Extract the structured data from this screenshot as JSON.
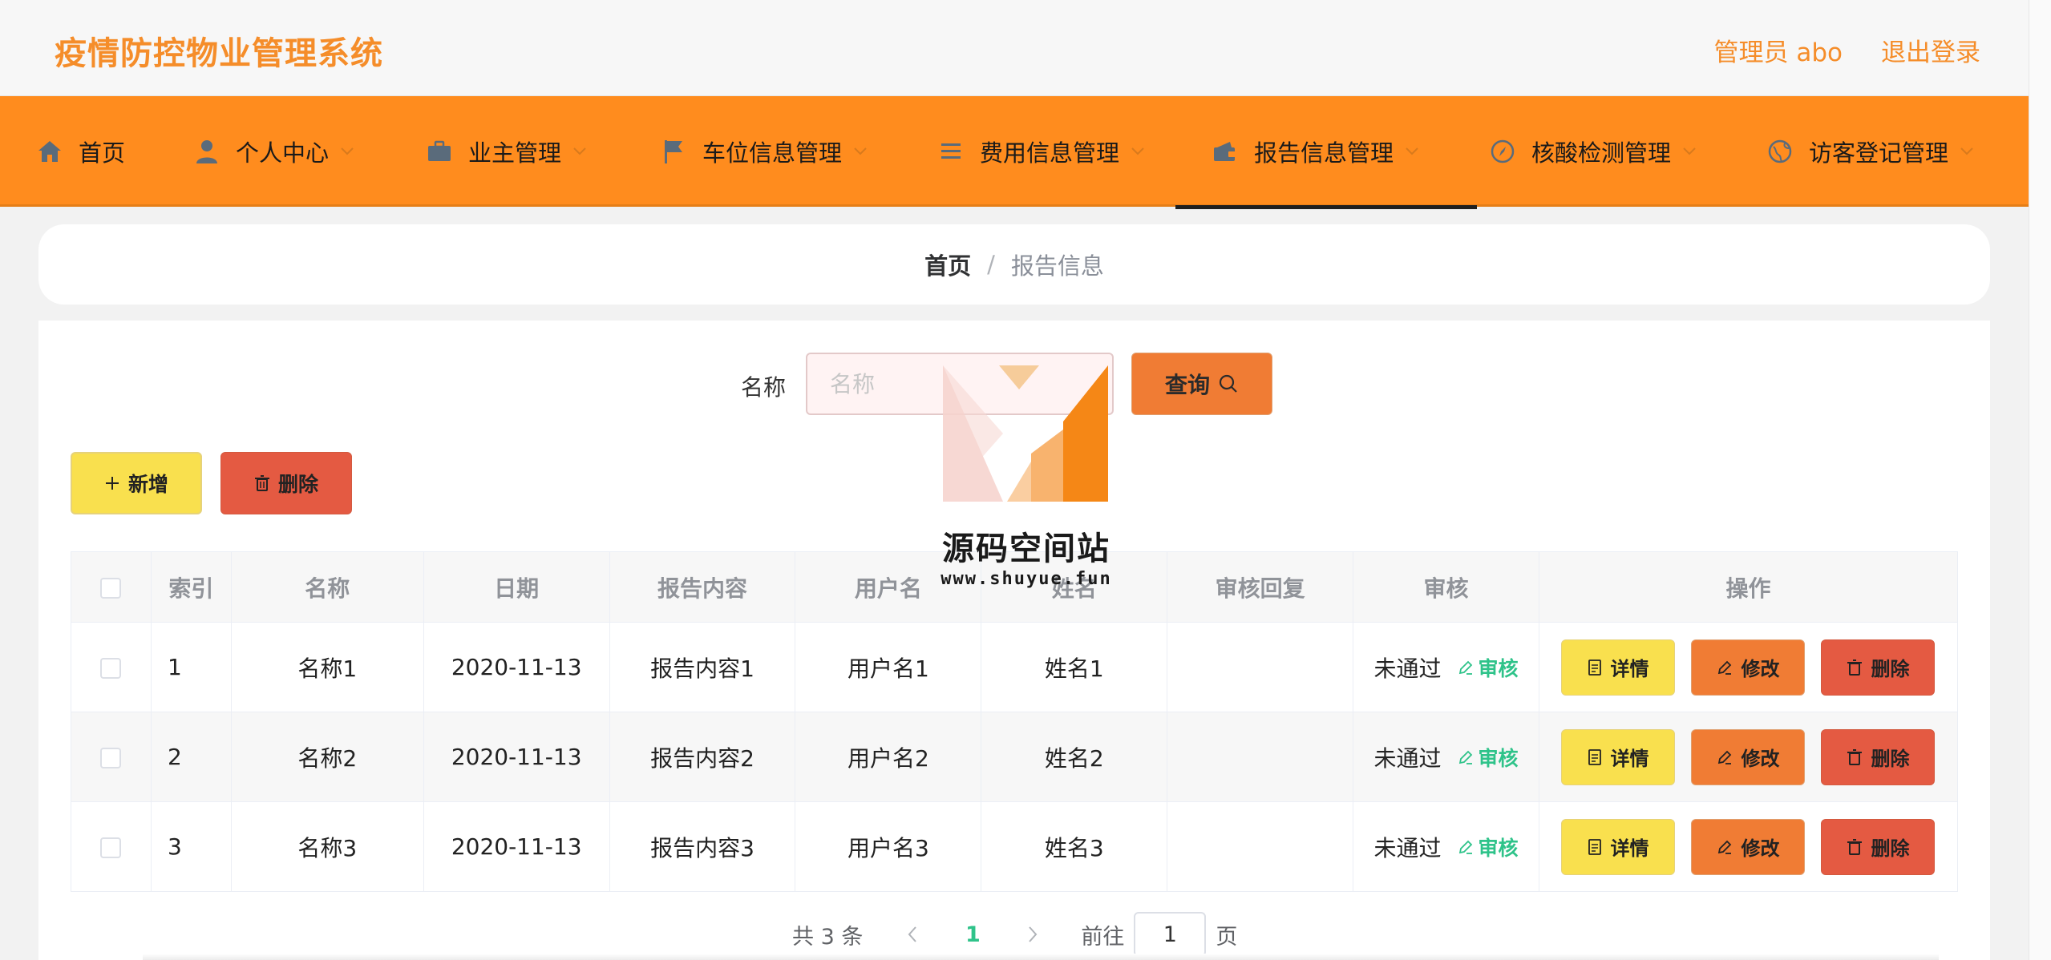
{
  "header": {
    "title": "疫情防控物业管理系统",
    "user_label": "管理员 abo",
    "logout_label": "退出登录"
  },
  "nav": {
    "items": [
      {
        "label": "首页",
        "icon": "home-icon"
      },
      {
        "label": "个人中心",
        "icon": "user-icon"
      },
      {
        "label": "业主管理",
        "icon": "briefcase-icon"
      },
      {
        "label": "车位信息管理",
        "icon": "flag-icon"
      },
      {
        "label": "费用信息管理",
        "icon": "list-icon"
      },
      {
        "label": "报告信息管理",
        "icon": "wallet-icon"
      },
      {
        "label": "核酸检测管理",
        "icon": "compass-icon"
      },
      {
        "label": "访客登记管理",
        "icon": "globe-icon"
      }
    ],
    "active_index": 5
  },
  "breadcrumb": {
    "home": "首页",
    "separator": "/",
    "current": "报告信息"
  },
  "search": {
    "label": "名称",
    "placeholder": "名称",
    "value": "",
    "button_label": "查询"
  },
  "actions": {
    "add_label": "新增",
    "delete_label": "删除"
  },
  "table": {
    "headers": [
      "索引",
      "名称",
      "日期",
      "报告内容",
      "用户名",
      "姓名",
      "审核回复",
      "审核",
      "操作"
    ],
    "rows": [
      {
        "index": "1",
        "name": "名称1",
        "date": "2020-11-13",
        "content": "报告内容1",
        "username": "用户名1",
        "realname": "姓名1",
        "reply": "",
        "status": "未通过"
      },
      {
        "index": "2",
        "name": "名称2",
        "date": "2020-11-13",
        "content": "报告内容2",
        "username": "用户名2",
        "realname": "姓名2",
        "reply": "",
        "status": "未通过"
      },
      {
        "index": "3",
        "name": "名称3",
        "date": "2020-11-13",
        "content": "报告内容3",
        "username": "用户名3",
        "realname": "姓名3",
        "reply": "",
        "status": "未通过"
      }
    ],
    "audit_label": "审核",
    "detail_label": "详情",
    "edit_label": "修改",
    "row_delete_label": "删除"
  },
  "pagination": {
    "total_text": "共 3 条",
    "current_page": "1",
    "goto_prefix": "前往",
    "goto_value": "1",
    "goto_suffix": "页"
  },
  "watermark": {
    "name": "源码空间站",
    "url": "www.shuyue.fun"
  },
  "colors": {
    "accent": "#ff8c1e",
    "title": "#f58d2a",
    "yellow_btn": "#f9e04e",
    "orange_btn": "#f07c34",
    "red_btn": "#e45a42",
    "success": "#2fc38a"
  }
}
